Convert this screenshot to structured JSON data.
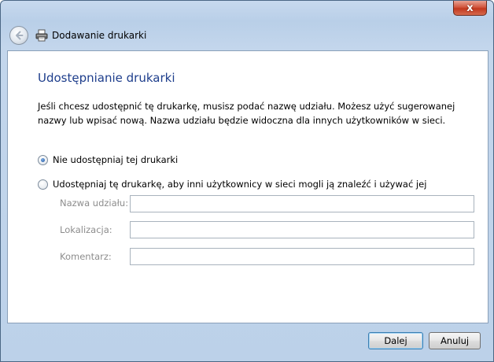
{
  "window": {
    "close_glyph": "x",
    "nav_title": "Dodawanie drukarki",
    "back_icon": "back-arrow-icon",
    "printer_icon": "printer-icon"
  },
  "main": {
    "heading": "Udostępnianie drukarki",
    "description": "Jeśli chcesz udostępnić tę drukarkę, musisz podać nazwę udziału. Możesz użyć sugerowanej nazwy lub wpisać nową. Nazwa udziału będzie widoczna dla innych użytkowników w sieci.",
    "options": [
      {
        "label": "Nie udostępniaj tej drukarki",
        "selected": true
      },
      {
        "label": "Udostępniaj tę drukarkę, aby inni użytkownicy w sieci mogli ją znaleźć i używać jej",
        "selected": false
      }
    ],
    "fields": [
      {
        "label": "Nazwa udziału:",
        "value": ""
      },
      {
        "label": "Lokalizacja:",
        "value": ""
      },
      {
        "label": "Komentarz:",
        "value": ""
      }
    ]
  },
  "footer": {
    "next_label": "Dalej",
    "cancel_label": "Anuluj"
  },
  "colors": {
    "heading": "#1e3e8c",
    "disabled_text": "#8d8d8d",
    "close_button": "#c2381e"
  }
}
